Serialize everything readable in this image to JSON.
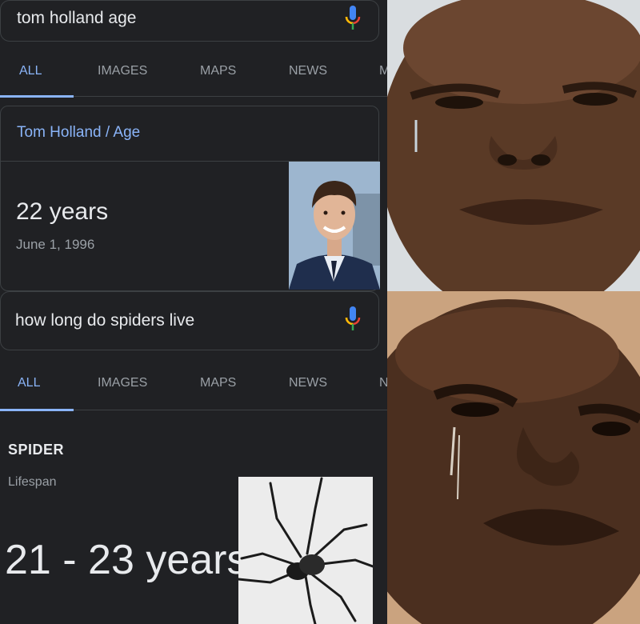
{
  "top": {
    "search_query": "tom holland age",
    "tabs": [
      "ALL",
      "IMAGES",
      "MAPS",
      "NEWS",
      "M"
    ],
    "breadcrumb": {
      "subject": "Tom Holland",
      "separator": "/",
      "attribute": "Age"
    },
    "answer": {
      "value": "22 years",
      "date": "June 1, 1996"
    }
  },
  "bottom": {
    "search_query": "how long do spiders live",
    "tabs": [
      "ALL",
      "IMAGES",
      "MAPS",
      "NEWS",
      "N"
    ],
    "result": {
      "title": "SPIDER",
      "subtitle": "Lifespan",
      "value": "21 - 23 years"
    }
  },
  "colors": {
    "background": "#202124",
    "accent": "#8ab4f8",
    "text": "#e8eaed",
    "muted": "#9aa0a6"
  }
}
